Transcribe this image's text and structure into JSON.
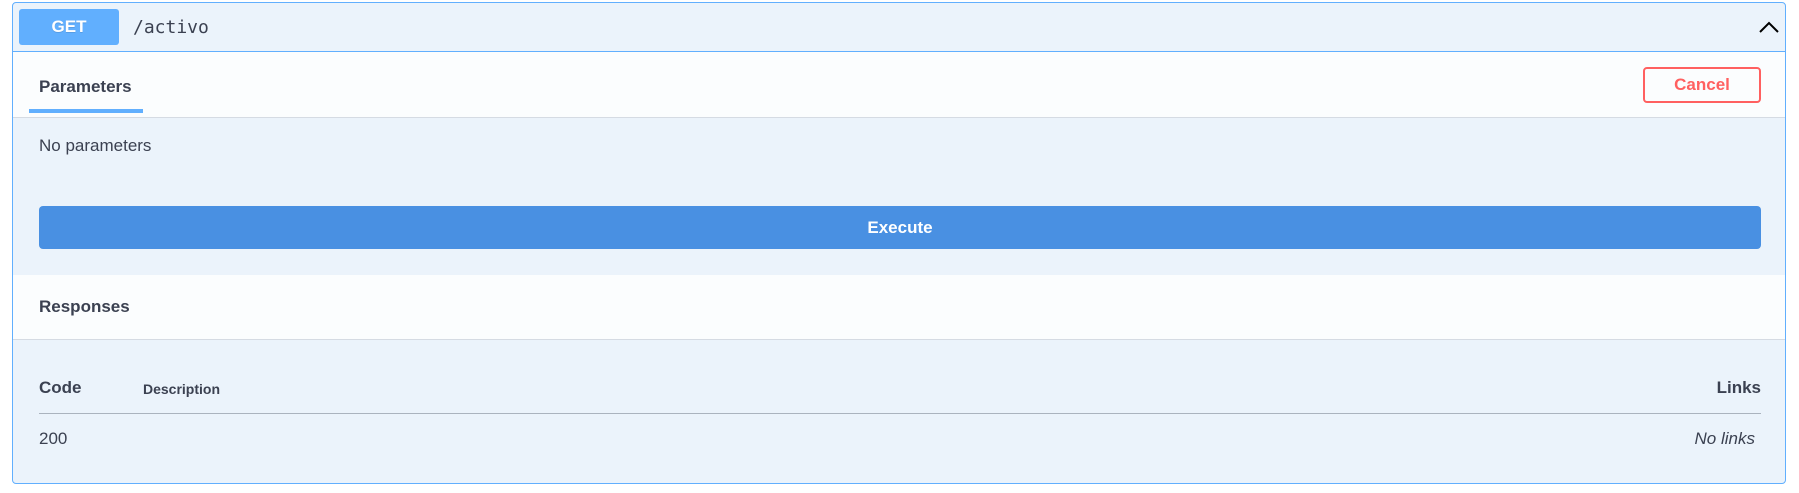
{
  "operation": {
    "method": "GET",
    "path": "/activo",
    "method_color": "#61affe"
  },
  "tabs": {
    "parameters_label": "Parameters",
    "cancel_label": "Cancel"
  },
  "parameters": {
    "empty_text": "No parameters"
  },
  "actions": {
    "execute_label": "Execute"
  },
  "responses": {
    "title": "Responses",
    "columns": {
      "code": "Code",
      "description": "Description",
      "links": "Links"
    },
    "rows": [
      {
        "code": "200",
        "description": "",
        "links": "No links"
      }
    ]
  },
  "icons": {
    "collapse": "chevron-up-icon"
  },
  "colors": {
    "accent": "#61affe",
    "execute": "#4990e2",
    "cancel": "#ff6060"
  }
}
